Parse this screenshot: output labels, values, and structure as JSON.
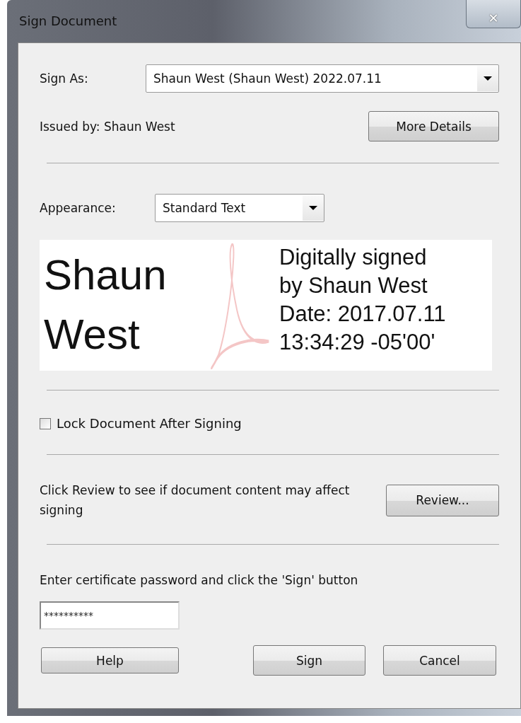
{
  "window": {
    "title": "Sign Document",
    "close": "✕"
  },
  "sign_as": {
    "label": "Sign As:",
    "value": "Shaun West (Shaun West) 2022.07.11"
  },
  "issued_by": "Issued by: Shaun West",
  "more_details_button": "More Details",
  "appearance": {
    "label": "Appearance:",
    "value": "Standard Text"
  },
  "preview": {
    "name_lines": [
      "Shaun",
      "West"
    ],
    "detail_lines": [
      "Digitally signed",
      "by Shaun West",
      "Date: 2017.07.11",
      "13:34:29 -05'00'"
    ]
  },
  "lock_document": {
    "label": "Lock Document After Signing",
    "checked": false
  },
  "review": {
    "text": "Click Review to see if document content may affect signing",
    "button": "Review..."
  },
  "password": {
    "label": "Enter certificate password and click the 'Sign' button",
    "value": "**********"
  },
  "buttons": [
    {
      "kind": "help",
      "label": "Help"
    },
    {
      "kind": "sign",
      "label": "Sign"
    },
    {
      "kind": "cancel",
      "label": "Cancel"
    }
  ]
}
